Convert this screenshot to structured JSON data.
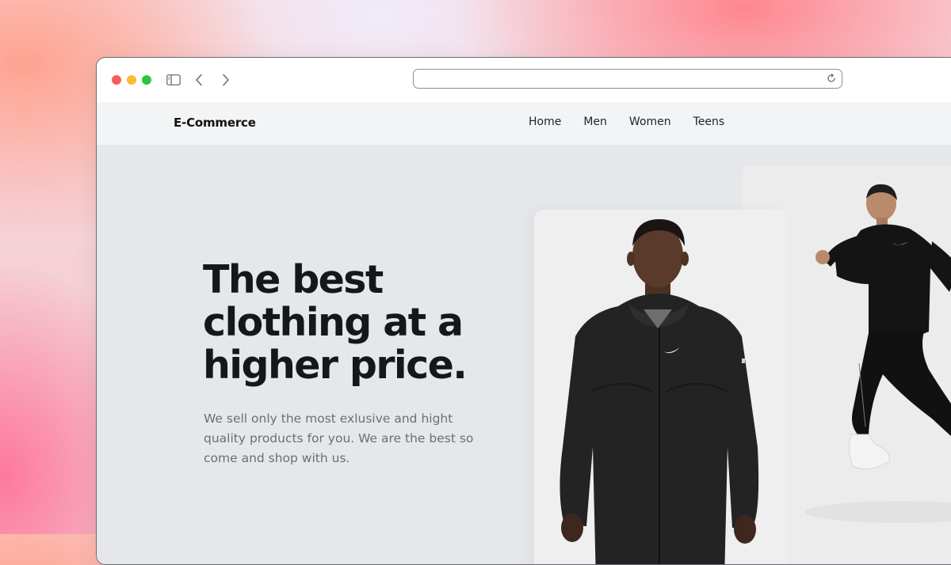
{
  "browser": {
    "url_value": "",
    "icons": [
      "sidebar-toggle-icon",
      "back-arrow-icon",
      "forward-arrow-icon",
      "reload-icon"
    ]
  },
  "site": {
    "brand": "E-Commerce",
    "nav": [
      "Home",
      "Men",
      "Women",
      "Teens"
    ]
  },
  "hero": {
    "title_lines": [
      "The best",
      "clothing at a",
      "higher price."
    ],
    "subtitle": "We sell only the most exlusive and hight quality products for you. We are the best so come and shop with us."
  },
  "images": {
    "front": "model-in-black-hooded-jacket",
    "back": "runner-in-black-sportswear"
  },
  "colors": {
    "accent_dark": "#16171a",
    "page_bg": "#e5e7ea",
    "header_bg": "#f3f4f6",
    "muted_text": "#6b6f76"
  }
}
